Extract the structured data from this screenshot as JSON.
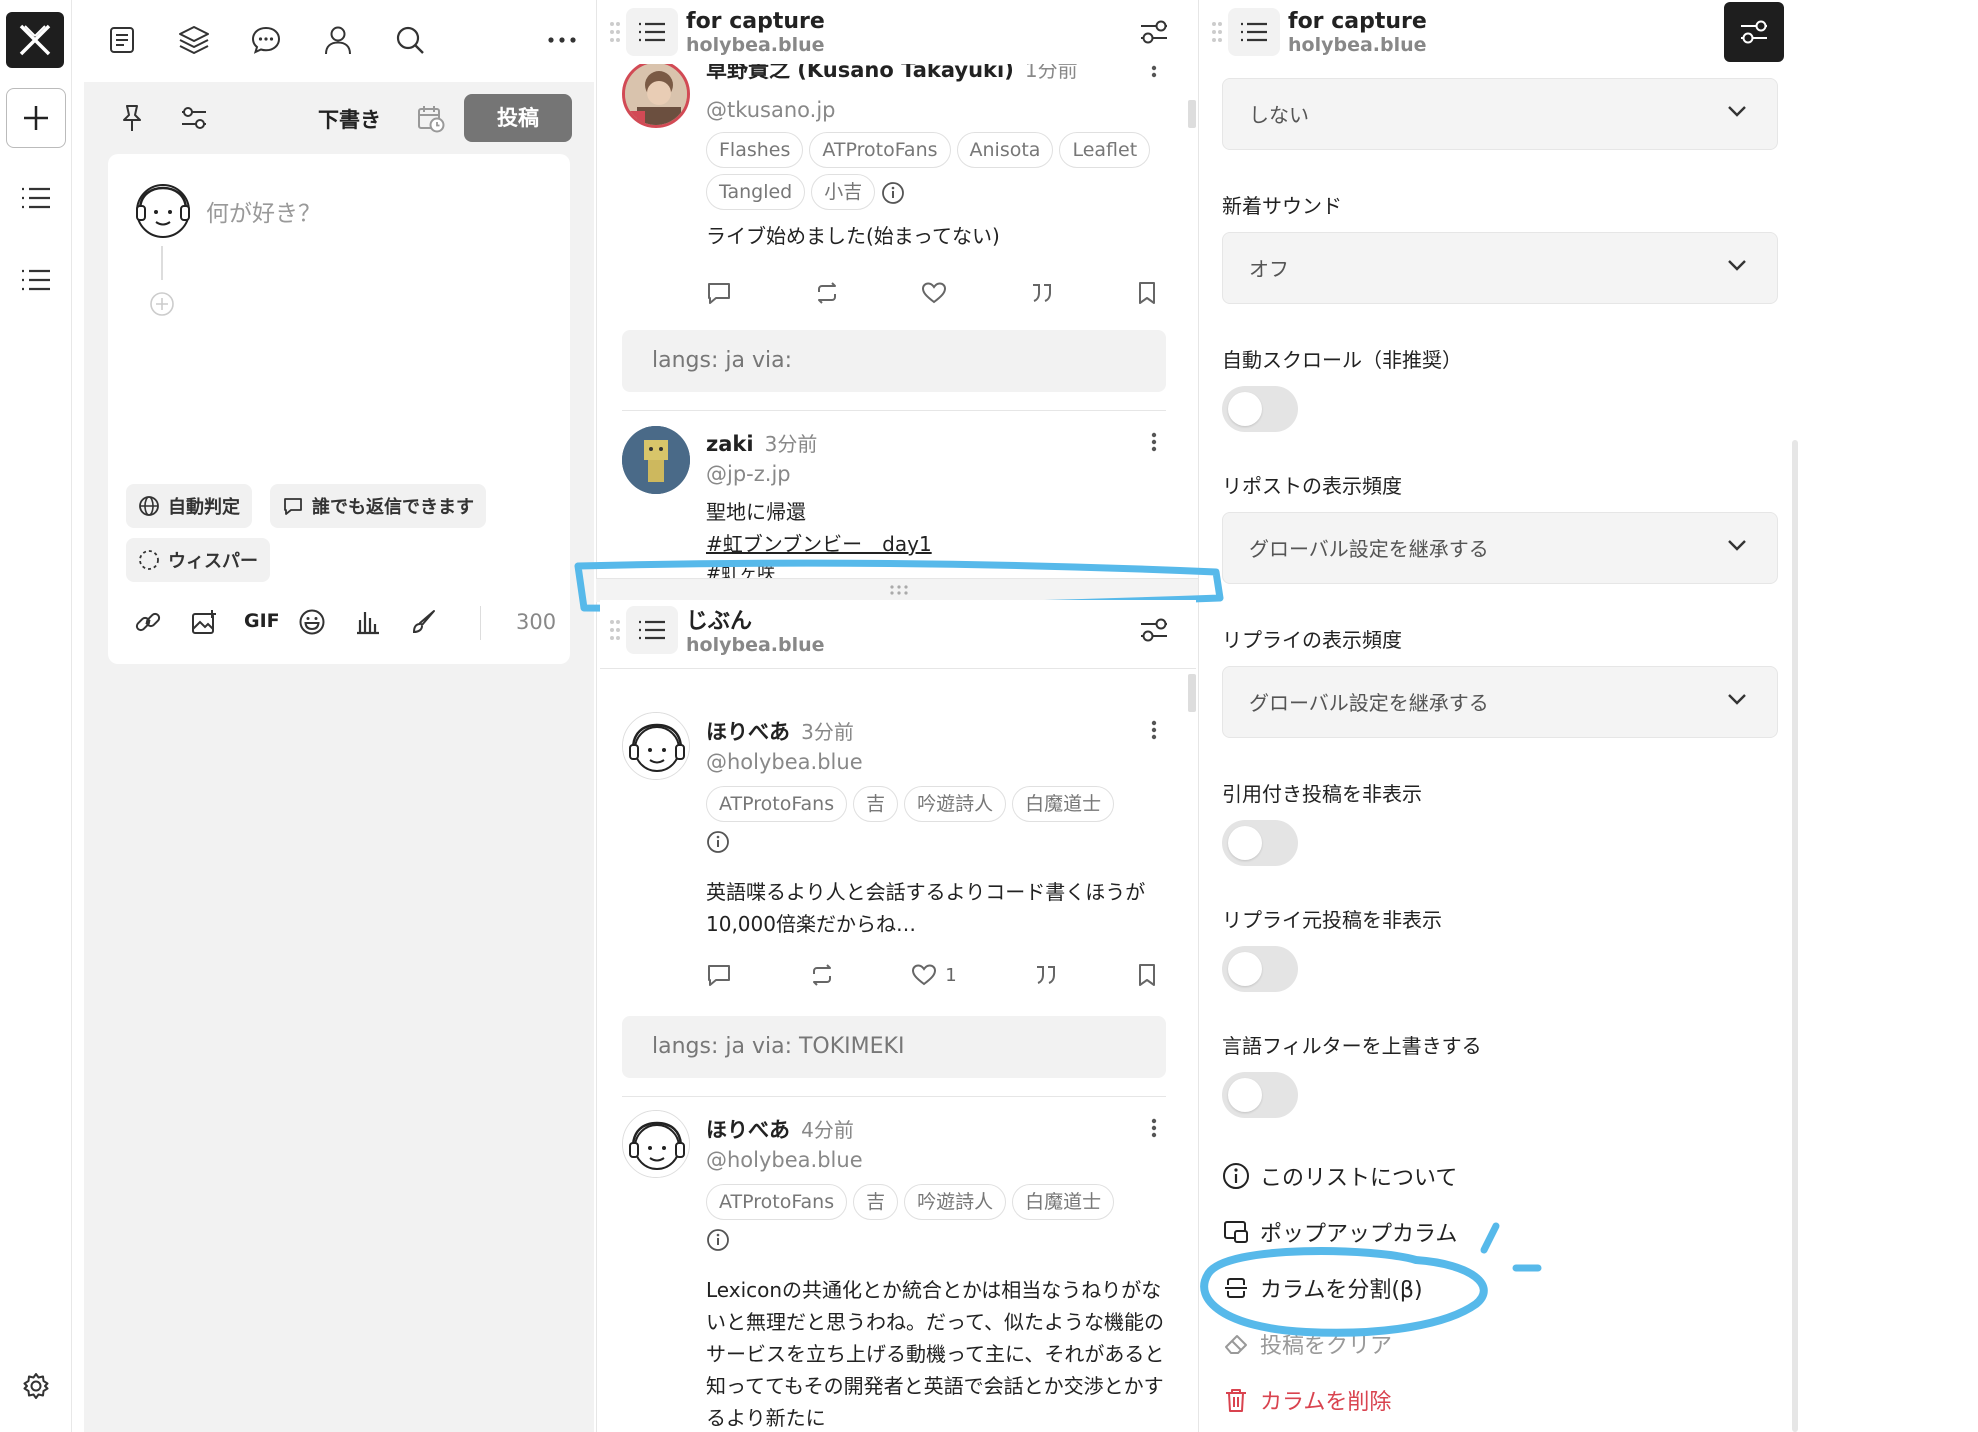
{
  "composer": {
    "draft_label": "下書き",
    "post_label": "投稿",
    "placeholder": "何が好き？",
    "lang_chip": "自動判定",
    "reply_chip": "誰でも返信できます",
    "whisper_chip": "ウィスパー",
    "gif_label": "GIF",
    "char_count": "300"
  },
  "column1": {
    "title": "for capture",
    "subtitle": "holybea.blue",
    "posts": [
      {
        "name": "草野貴之 (Kusano Takayuki)",
        "time": "1分前",
        "handle": "@tkusano.jp",
        "tags": [
          "Flashes",
          "ATProtoFans",
          "Anisota",
          "Leaflet",
          "Tangled",
          "小吉"
        ],
        "text": "ライブ始めました(始まってない)",
        "langs": "langs: ja   via:"
      },
      {
        "name": "zaki",
        "time": "3分前",
        "handle": "@jp-z.jp",
        "line1": "聖地に帰還",
        "line2": "#虹ブンブンビー＿day1",
        "line3": "#虹ヶ咲"
      }
    ]
  },
  "column2": {
    "title": "じぶん",
    "subtitle": "holybea.blue",
    "posts": [
      {
        "name": "ほりべあ",
        "time": "3分前",
        "handle": "@holybea.blue",
        "tags": [
          "ATProtoFans",
          "吉",
          "吟遊詩人",
          "白魔道士"
        ],
        "text": "英語喋るより人と会話するよりコード書くほうが10,000倍楽だからね…",
        "likes": "1",
        "langs": "langs: ja   via: TOKIMEKI"
      },
      {
        "name": "ほりべあ",
        "time": "4分前",
        "handle": "@holybea.blue",
        "tags": [
          "ATProtoFans",
          "吉",
          "吟遊詩人",
          "白魔道士"
        ],
        "text": "Lexiconの共通化とか統合とかは相当なうねりがないと無理だと思うわね。だって、似たような機能のサービスを立ち上げる動機って主に、それがあると知っててもその開発者と英語で会話とか交渉とかするより新たに"
      }
    ]
  },
  "settings": {
    "title": "for capture",
    "subtitle": "holybea.blue",
    "select_top": "しない",
    "new_sound_label": "新着サウンド",
    "new_sound_value": "オフ",
    "autoscroll_label": "自動スクロール（非推奨）",
    "repost_freq_label": "リポストの表示頻度",
    "repost_freq_value": "グローバル設定を継承する",
    "reply_freq_label": "リプライの表示頻度",
    "reply_freq_value": "グローバル設定を継承する",
    "hide_quote_label": "引用付き投稿を非表示",
    "hide_reply_parent_label": "リプライ元投稿を非表示",
    "lang_override_label": "言語フィルターを上書きする",
    "about_list": "このリストについて",
    "popup_column": "ポップアップカラム",
    "split_column": "カラムを分割(β)",
    "clear_posts": "投稿をクリア",
    "delete_column": "カラムを削除"
  },
  "colors": {
    "accent_dark": "#222222",
    "danger": "#d9434f",
    "annotation": "#57b9ea"
  }
}
